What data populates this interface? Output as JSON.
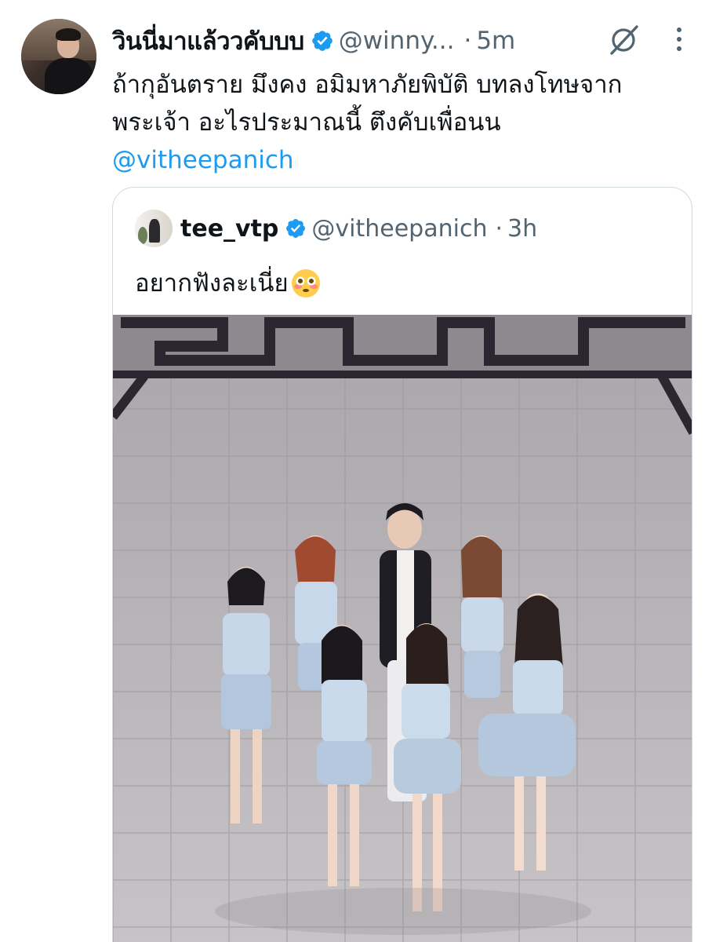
{
  "tweet": {
    "author_name": "วินนี่มาแล้ววคับบบ",
    "author_handle": "@winny...",
    "separator": "·",
    "timestamp": "5m",
    "text_line1": "ถ้ากุอันตราย มึงคง อมิมหาภัยพิบัติ บทลงโทษจาก",
    "text_line2": "พระเจ้า อะไรประมาณนี้ ตึงคับเพื่อนน",
    "mention": "@vitheepanich",
    "icons": {
      "verified": "verified-badge-icon",
      "grok": "grok-icon",
      "more": "more-options-icon"
    }
  },
  "quoted": {
    "author_name": "tee_vtp",
    "author_handle": "@vitheepanich",
    "separator": "·",
    "timestamp": "3h",
    "text": "อยากฟังละเนี่ย",
    "emoji": "flushed-face-emoji"
  },
  "colors": {
    "link": "#1d9bf0",
    "verified": "#1d9bf0",
    "secondary_text": "#536471",
    "border": "#cfd9de"
  }
}
